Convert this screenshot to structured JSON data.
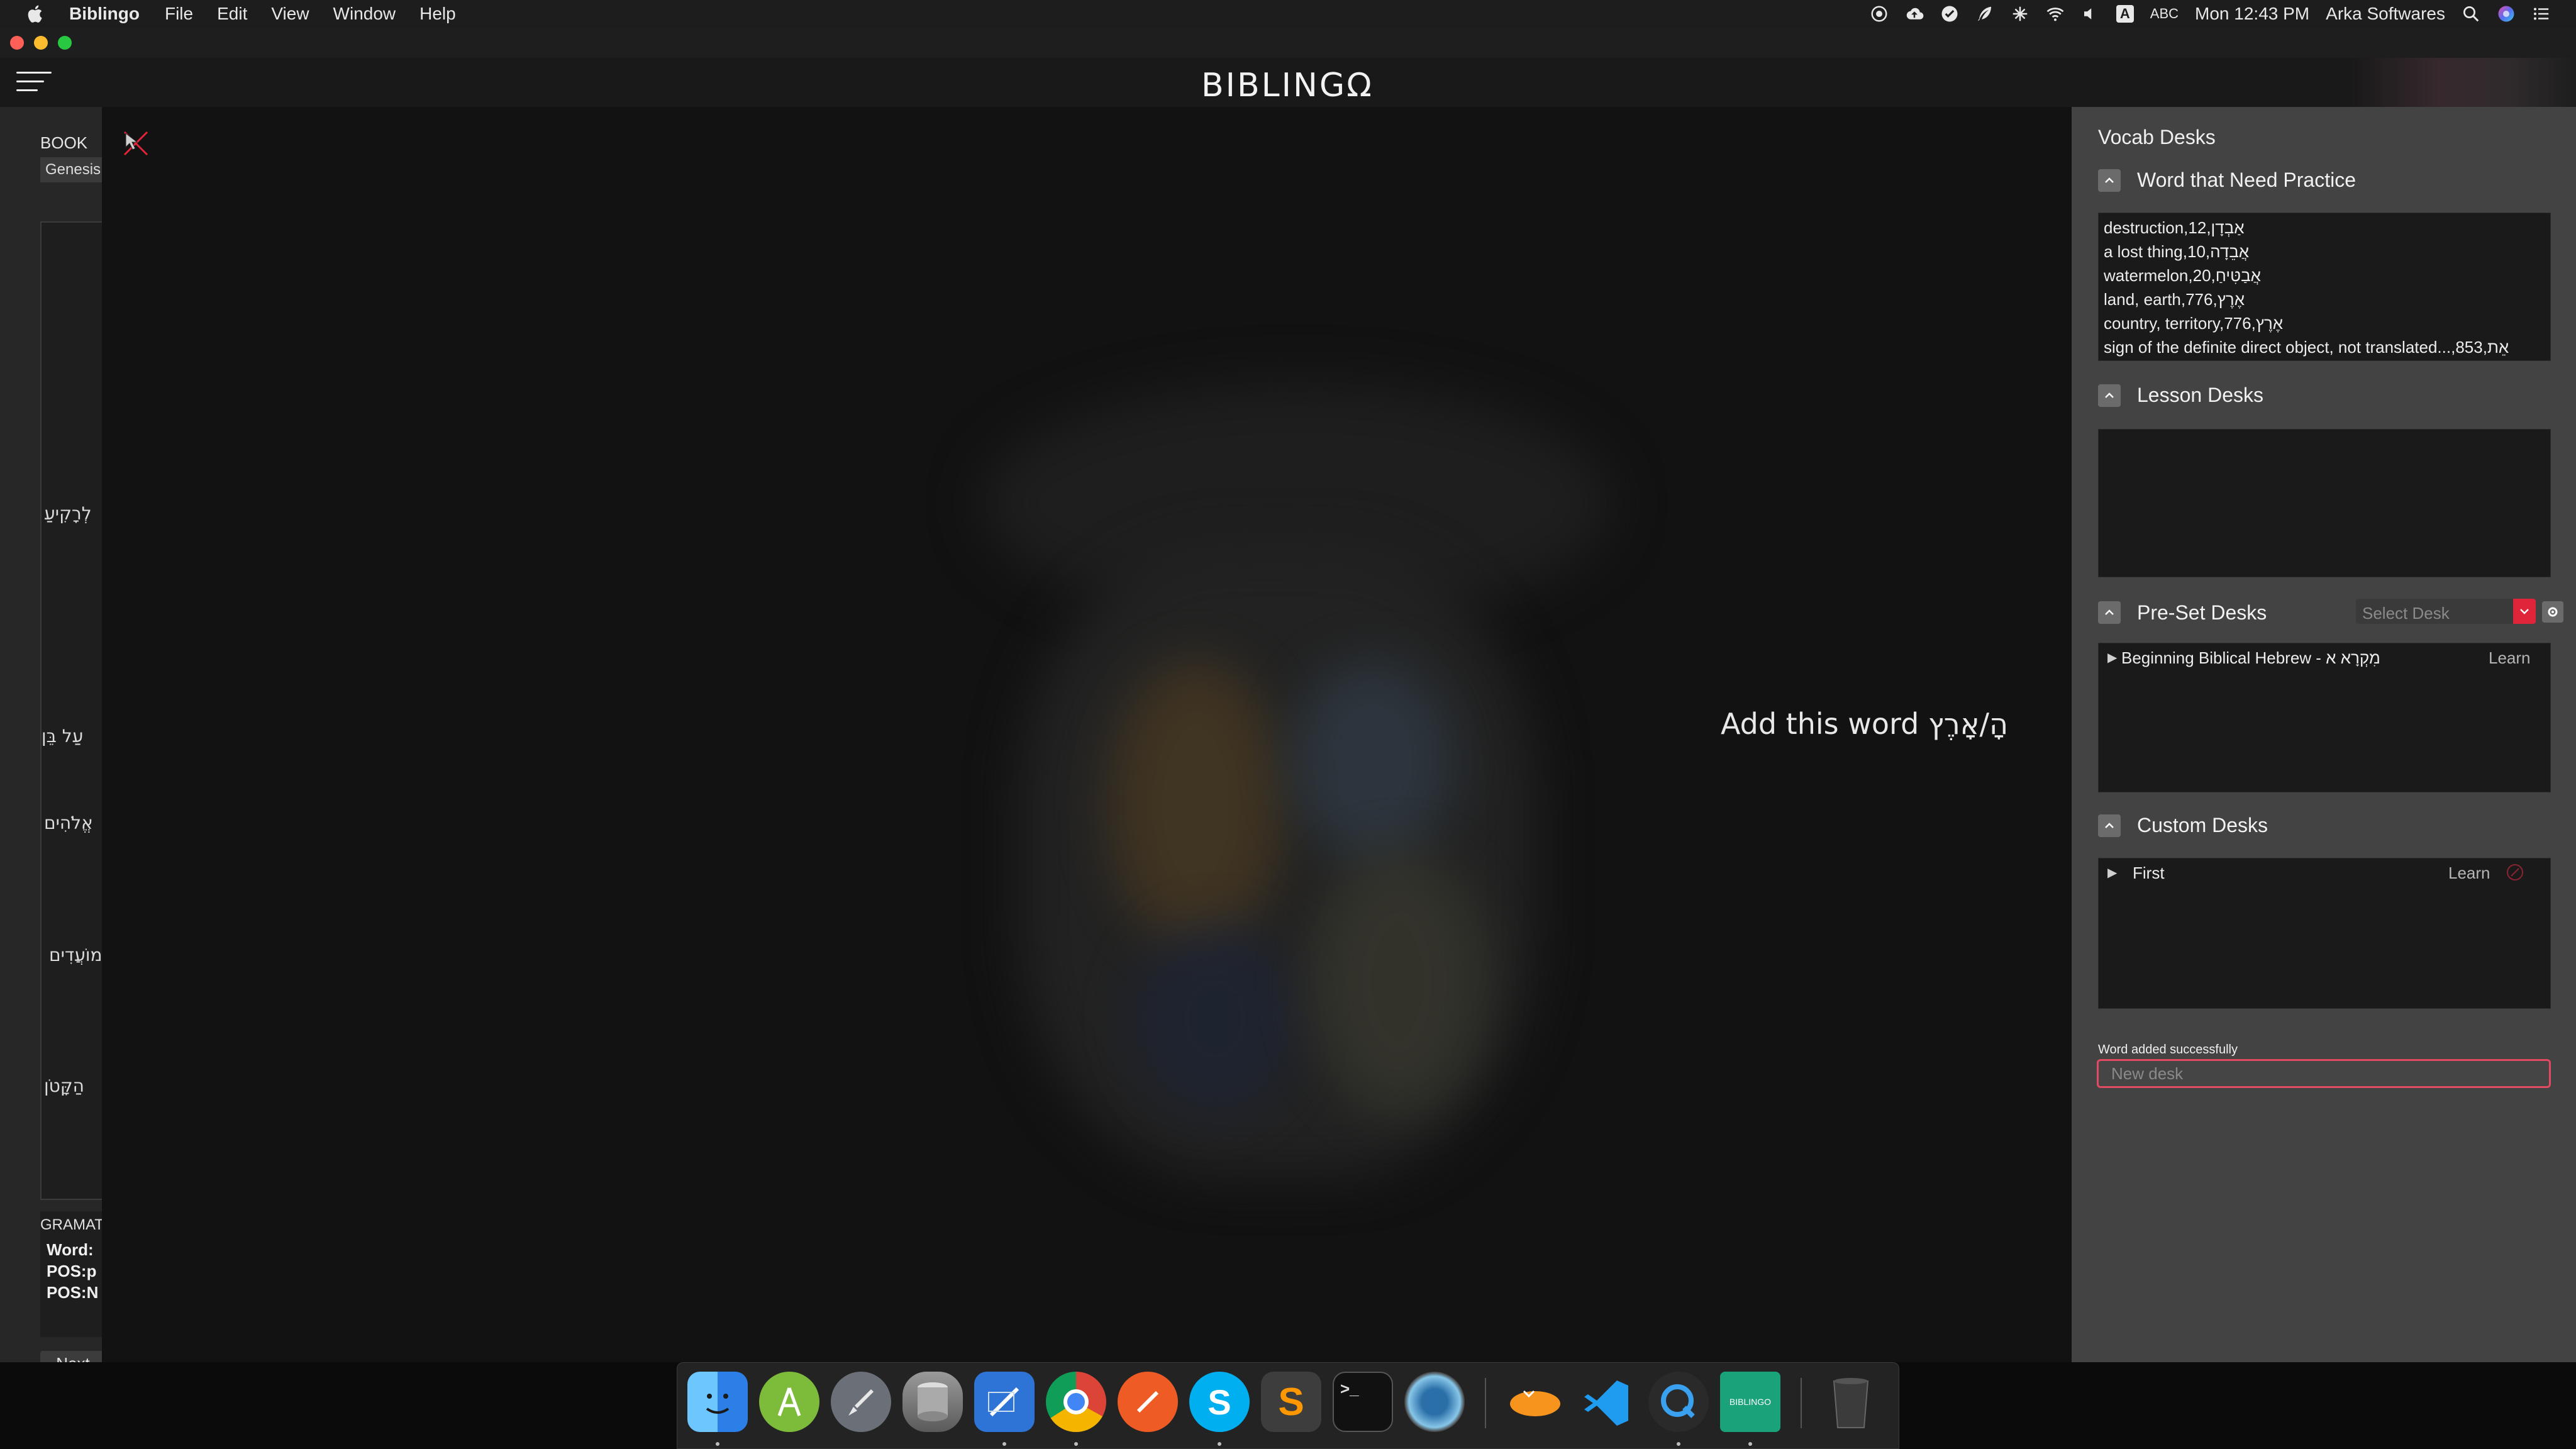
{
  "menubar": {
    "app_name": "Biblingo",
    "menus": [
      "File",
      "Edit",
      "View",
      "Window",
      "Help"
    ],
    "ime_label": "ABC",
    "clock": "Mon 12:43 PM",
    "user": "Arka Softwares"
  },
  "header": {
    "logo": "BIBLINGΩ"
  },
  "left_panel": {
    "book_label": "BOOK",
    "book_value": "Genesis",
    "hebrew_words": [
      "לְרָקִיעַ",
      "עַל  בֵּן",
      "אֱלֹהִים",
      "מוֹעֲדִים",
      "הַקָּטֹן"
    ],
    "grammar_label": "GRAMATICAL",
    "grammar_lines": [
      "Word:",
      "POS:p",
      "POS:N"
    ],
    "next_label": "Next"
  },
  "center": {
    "add_word_text": "Add this word הָ/אָרֶץ"
  },
  "right_panel": {
    "title": "Vocab Desks",
    "practice": {
      "title": "Word that Need Practice",
      "words": [
        "destruction,אַבְדָן,12",
        "a lost thing,אֲבֵדָה,10",
        "watermelon,אֲבַטִּיחַ,20",
        "land, earth,אֶרֶץ,776",
        "country, territory,אֶרֶץ,776",
        "sign of the definite direct object, not translated...,אֵת,853"
      ]
    },
    "lesson": {
      "title": "Lesson Desks"
    },
    "preset": {
      "title": "Pre-Set Desks",
      "select_placeholder": "Select Desk",
      "desks": [
        {
          "name": "Beginning Biblical Hebrew - מִקְרָא א",
          "action": "Learn"
        }
      ]
    },
    "custom": {
      "title": "Custom Desks",
      "desks": [
        {
          "name": "First",
          "action": "Learn"
        }
      ]
    },
    "status_message": "Word added successfully",
    "new_desk_placeholder": "New desk"
  },
  "dock": {
    "apps": [
      "finder",
      "android-studio",
      "launchpad",
      "database",
      "xcode",
      "chrome",
      "postman",
      "skype",
      "sublime-text",
      "terminal",
      "camera",
      "cyberduck",
      "vscode",
      "quicktime",
      "biblingo",
      "trash"
    ]
  },
  "colors": {
    "accent_red": "#e0243a",
    "panel_gray": "#434343",
    "input_border": "#e24a62"
  }
}
